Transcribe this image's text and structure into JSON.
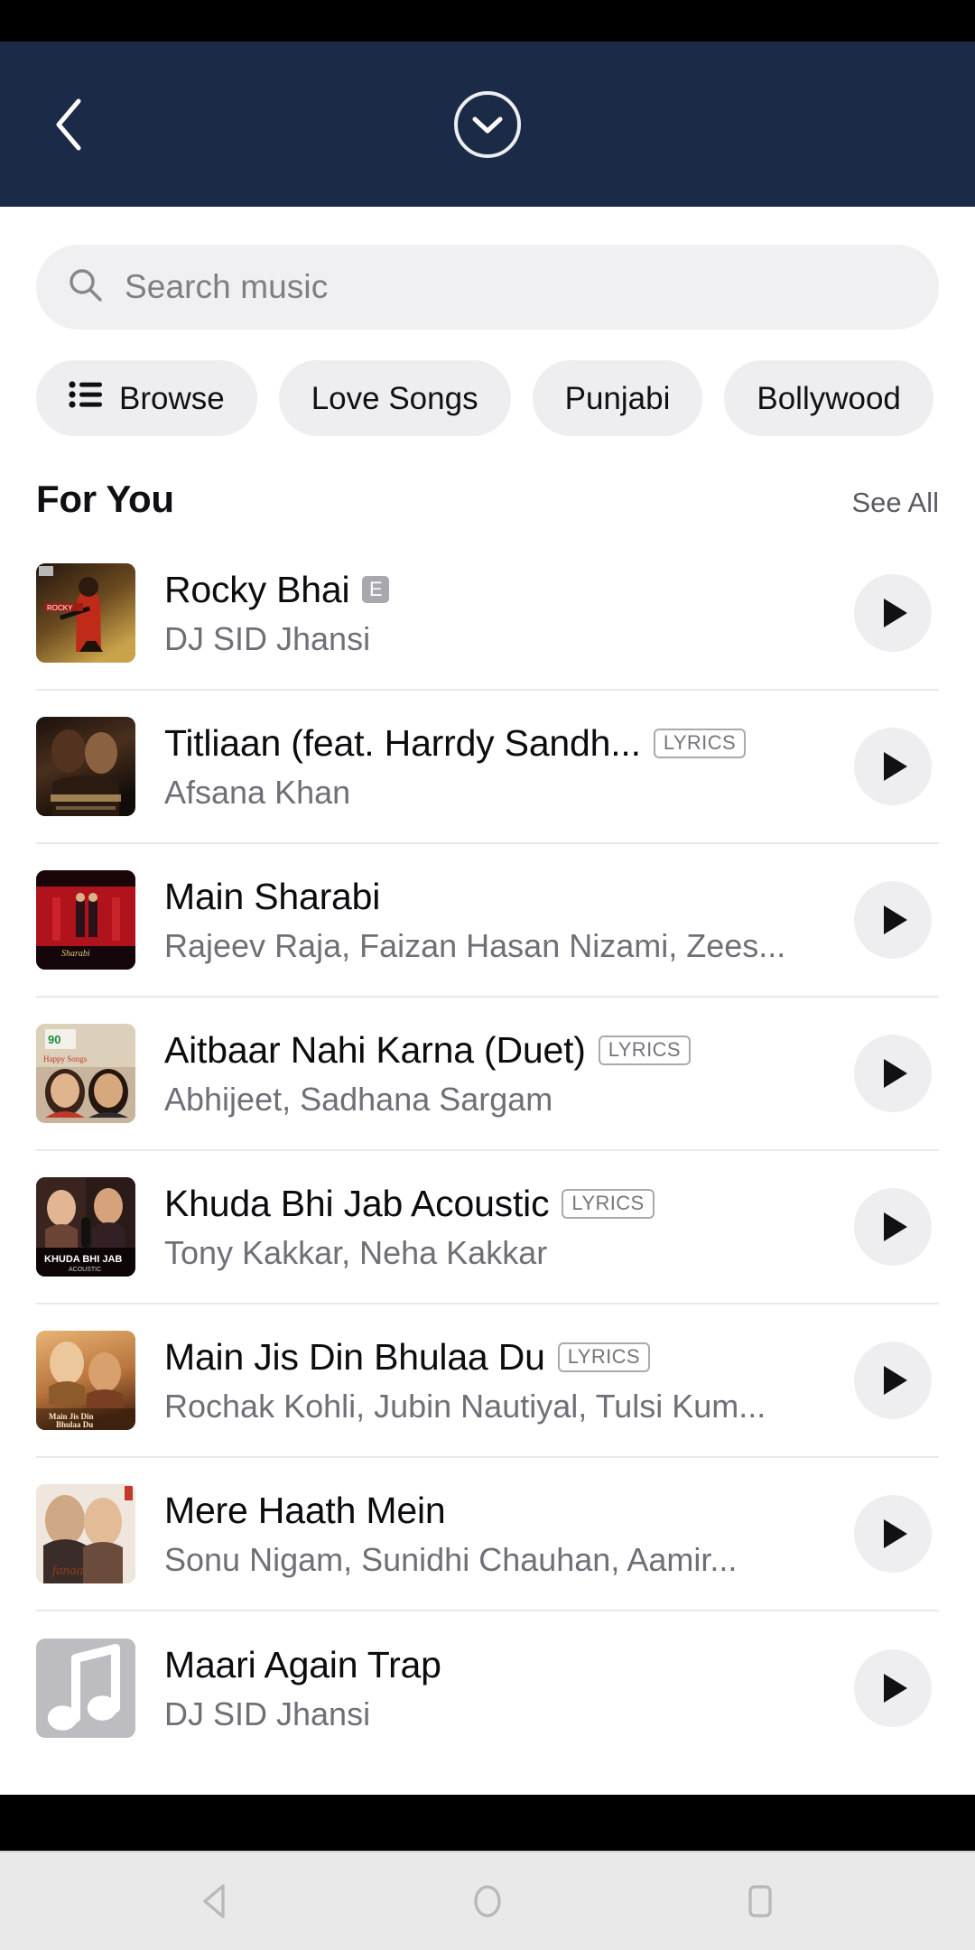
{
  "theme": {
    "header_bg": "#1b2a47",
    "accent_chip_bg": "#eeeef0",
    "search_bg": "#f0f0f2",
    "page_bg": "#ffffff",
    "nav_bg": "#e9e9e9"
  },
  "header": {
    "back_icon": "chevron-left-icon",
    "collapse_icon": "chevron-down-circle-icon"
  },
  "search": {
    "icon": "search-icon",
    "placeholder": "Search music",
    "value": ""
  },
  "chips": [
    {
      "label": "Browse",
      "icon": "list-icon"
    },
    {
      "label": "Love Songs",
      "icon": ""
    },
    {
      "label": "Punjabi",
      "icon": ""
    },
    {
      "label": "Bollywood",
      "icon": ""
    }
  ],
  "section": {
    "title": "For You",
    "see_all_label": "See All"
  },
  "songs": [
    {
      "title": "Rocky Bhai",
      "artist": "DJ SID Jhansi",
      "badge": "E",
      "badge_type": "explicit",
      "art": "rocky-bhai-art",
      "play_icon": "play-icon"
    },
    {
      "title": "Titliaan (feat. Harrdy Sandh...",
      "artist": "Afsana Khan",
      "badge": "LYRICS",
      "badge_type": "lyrics",
      "art": "titliaan-art",
      "play_icon": "play-icon"
    },
    {
      "title": "Main Sharabi",
      "artist": "Rajeev Raja, Faizan Hasan Nizami, Zees...",
      "badge": "",
      "badge_type": "none",
      "art": "main-sharabi-art",
      "play_icon": "play-icon"
    },
    {
      "title": "Aitbaar Nahi Karna (Duet)",
      "artist": "Abhijeet, Sadhana Sargam",
      "badge": "LYRICS",
      "badge_type": "lyrics",
      "art": "aitbaar-nahi-karna-art",
      "play_icon": "play-icon"
    },
    {
      "title": "Khuda Bhi Jab Acoustic",
      "artist": "Tony Kakkar, Neha Kakkar",
      "badge": "LYRICS",
      "badge_type": "lyrics",
      "art": "khuda-bhi-jab-art",
      "play_icon": "play-icon"
    },
    {
      "title": "Main Jis Din Bhulaa Du",
      "artist": "Rochak Kohli, Jubin Nautiyal, Tulsi Kum...",
      "badge": "LYRICS",
      "badge_type": "lyrics",
      "art": "main-jis-din-bhulaa-du-art",
      "play_icon": "play-icon"
    },
    {
      "title": "Mere Haath Mein",
      "artist": "Sonu Nigam, Sunidhi Chauhan, Aamir...",
      "badge": "",
      "badge_type": "none",
      "art": "fanaa-art",
      "play_icon": "play-icon"
    },
    {
      "title": "Maari Again Trap",
      "artist": "DJ SID Jhansi",
      "badge": "",
      "badge_type": "none",
      "art": "music-note-placeholder",
      "play_icon": "play-icon"
    }
  ],
  "nav_bar": {
    "items": [
      {
        "icon": "back-triangle-icon"
      },
      {
        "icon": "home-circle-icon"
      },
      {
        "icon": "recents-square-icon"
      }
    ]
  }
}
